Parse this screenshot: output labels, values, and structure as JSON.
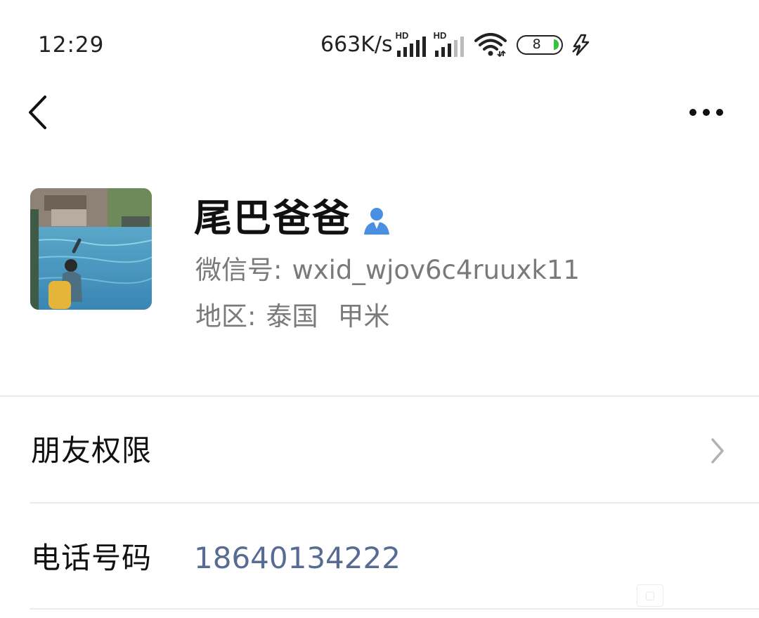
{
  "status_bar": {
    "time": "12:29",
    "net_speed": "663K/s",
    "signal_1_badge": "HD",
    "signal_2_badge": "HD",
    "battery_level": "8",
    "icons": [
      "signal-hd-icon",
      "signal-hd-icon",
      "wifi-icon",
      "battery-icon",
      "charging-icon"
    ]
  },
  "nav": {
    "back_icon": "chevron-left-icon",
    "more_icon": "more-horizontal-icon"
  },
  "profile": {
    "name": "尾巴爸爸",
    "wechat_id_label": "微信号:",
    "wechat_id": "wxid_wjov6c4ruuxk11",
    "region_label": "地区:",
    "region_country": "泰国",
    "region_city": "甲米",
    "contact_icon": "contact-person-icon"
  },
  "rows": {
    "friend_permissions_label": "朋友权限",
    "phone_label": "电话号码",
    "phone_value": "18640134222"
  },
  "colors": {
    "link_blue": "#576b95",
    "contact_icon_blue": "#4a90e2",
    "secondary_text": "#7a7a7a",
    "divider": "#ececec",
    "battery_green": "#36c23e"
  }
}
